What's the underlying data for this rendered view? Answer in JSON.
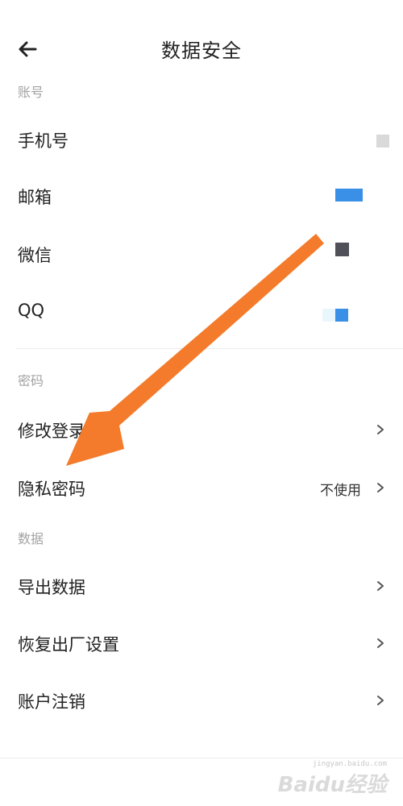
{
  "header": {
    "title": "数据安全"
  },
  "sections": {
    "account": "账号",
    "password": "密码",
    "data": "数据"
  },
  "account_rows": [
    {
      "label": "手机号",
      "status_color": "#d9d9d9"
    },
    {
      "label": "邮箱",
      "status_color": "#3a8fe6"
    },
    {
      "label": "微信",
      "status_color": "#505058"
    },
    {
      "label": "QQ",
      "status_color": "#3a8fe6"
    }
  ],
  "password_rows": [
    {
      "label": "修改登录密码"
    },
    {
      "label": "隐私密码",
      "value": "不使用"
    }
  ],
  "data_rows": [
    {
      "label": "导出数据"
    },
    {
      "label": "恢复出厂设置"
    },
    {
      "label": "账户注销"
    }
  ],
  "watermark": {
    "url": "jingyan.baidu.com",
    "brand": "Baidu经验"
  },
  "colors": {
    "arrow": "#f47b2b",
    "accent": "#3a8fe6"
  }
}
